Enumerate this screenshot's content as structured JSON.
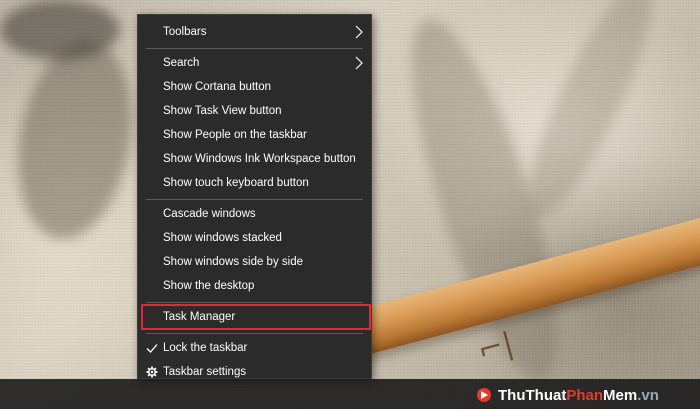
{
  "context_menu": {
    "items": [
      {
        "label": "Toolbars",
        "submenu": true
      },
      {
        "label": "Search",
        "submenu": true
      },
      {
        "label": "Show Cortana button"
      },
      {
        "label": "Show Task View button"
      },
      {
        "label": "Show People on the taskbar"
      },
      {
        "label": "Show Windows Ink Workspace button"
      },
      {
        "label": "Show touch keyboard button"
      },
      {
        "label": "Cascade windows"
      },
      {
        "label": "Show windows stacked"
      },
      {
        "label": "Show windows side by side"
      },
      {
        "label": "Show the desktop"
      },
      {
        "label": "Task Manager",
        "highlighted": true
      },
      {
        "label": "Lock the taskbar",
        "checked": true,
        "icon": "checkmark-icon"
      },
      {
        "label": "Taskbar settings",
        "icon": "gear-icon"
      }
    ]
  },
  "watermark": {
    "part1": "Thu",
    "part2": "Thuat",
    "part3": "Phan",
    "part4": "Mem",
    "part5": ".vn"
  },
  "colors": {
    "menu_background": "#2b2b2b",
    "highlight_border": "#e0283a",
    "taskbar": "#1e1e1e"
  }
}
